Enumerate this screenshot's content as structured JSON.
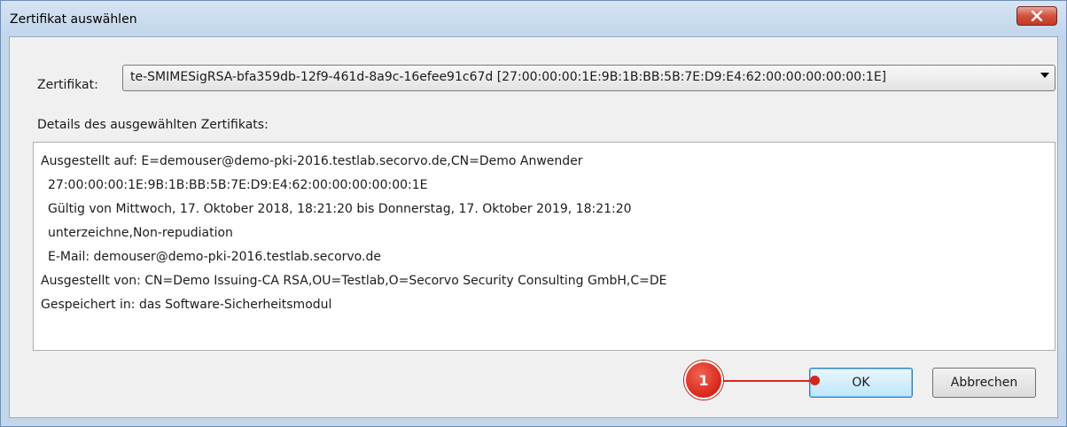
{
  "window": {
    "title": "Zertifikat auswählen",
    "close_icon": "close-icon"
  },
  "certificate": {
    "label": "Zertifikat:",
    "selected": "te-SMIMESigRSA-bfa359db-12f9-461d-8a9c-16efee91c67d [27:00:00:00:1E:9B:1B:BB:5B:7E:D9:E4:62:00:00:00:00:00:1E]"
  },
  "details": {
    "label": "Details des ausgewählten Zertifikats:",
    "lines": [
      "Ausgestellt auf: E=demouser@demo-pki-2016.testlab.secorvo.de,CN=Demo Anwender",
      "27:00:00:00:1E:9B:1B:BB:5B:7E:D9:E4:62:00:00:00:00:00:1E",
      "Gültig von Mittwoch, 17. Oktober 2018, 18:21:20 bis Donnerstag, 17. Oktober 2019, 18:21:20",
      "unterzeichne,Non-repudiation",
      "E-Mail: demouser@demo-pki-2016.testlab.secorvo.de",
      "Ausgestellt von: CN=Demo Issuing-CA RSA,OU=Testlab,O=Secorvo Security Consulting GmbH,C=DE",
      "Gespeichert in: das Software-Sicherheitsmodul"
    ]
  },
  "buttons": {
    "ok": "OK",
    "cancel": "Abbrechen"
  },
  "annotation": {
    "number": "1",
    "color": "#d7261a"
  }
}
